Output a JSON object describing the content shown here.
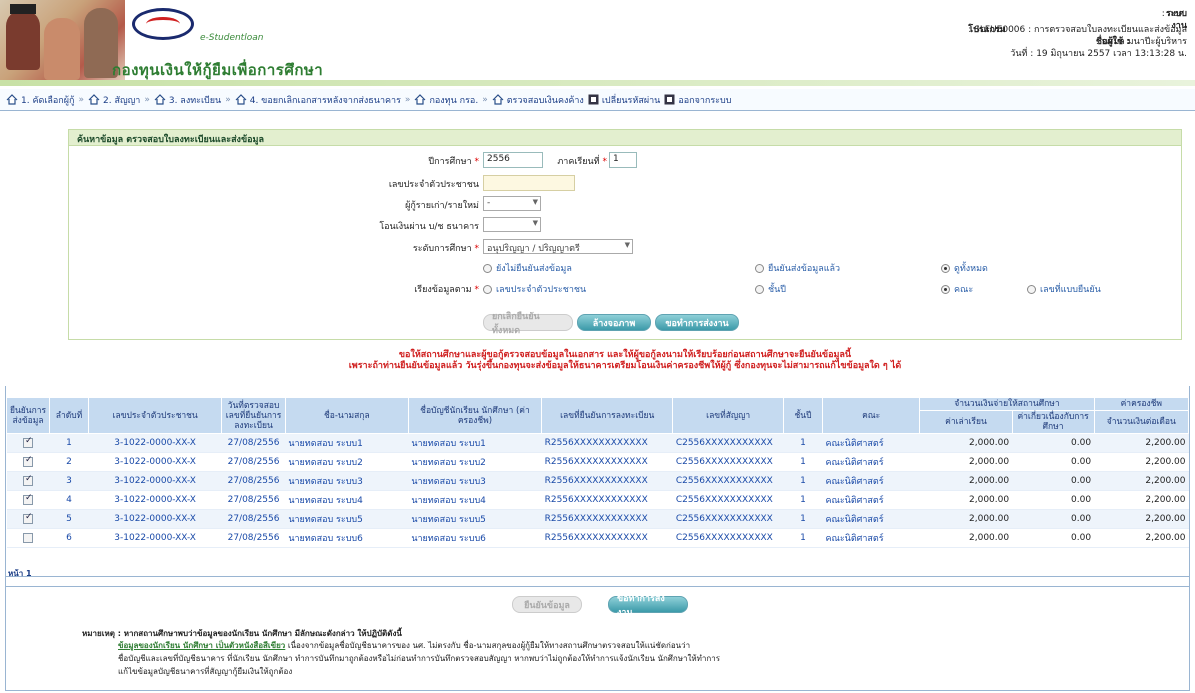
{
  "header": {
    "logo_sub": "e-Studentloan",
    "brand": "กองทุนเงินให้กู้ยืมเพื่อการศึกษา",
    "system_label": "ระบบงาน",
    "system_value": ": กยศ.",
    "program_label": "โปรแกรม",
    "program_value": ": SLFUE0006 : การตรวจสอบใบลงทะเบียนและส่งข้อมูล",
    "user_label": "ชื่อผู้ใช้ :",
    "user_value": ": นสมล มนาปีะผู้บริหาร",
    "date_value": "วันที่ : 19 มิถุนายน 2557 เวลา 13:13:28 น."
  },
  "menu": [
    {
      "label": "1. คัดเลือกผู้กู้",
      "icon": "home-icon"
    },
    {
      "label": "2. สัญญา",
      "icon": "home-icon"
    },
    {
      "label": "3. ลงทะเบียน",
      "icon": "home-icon"
    },
    {
      "label": "4. ขอยกเลิกเอกสารหลังจากส่งธนาคาร",
      "icon": "home-icon"
    },
    {
      "label": "กองทุน กรอ.",
      "icon": "home-icon"
    },
    {
      "label": "ตรวจสอบเงินคงค้าง",
      "icon": "home-icon"
    },
    {
      "label": "เปลี่ยนรหัสผ่าน",
      "icon": "box-icon"
    },
    {
      "label": "ออกจากระบบ",
      "icon": "box-icon"
    }
  ],
  "search": {
    "title": "ค้นหาข้อมูล ตรวจสอบใบลงทะเบียนและส่งข้อมูล",
    "year_label": "ปีการศึกษา",
    "year_value": "2556",
    "term_label": "ภาคเรียนที่",
    "term_value": "1",
    "citizen_label": "เลขประจำตัวประชาชน",
    "borrower_type_label": "ผู้กู้รายเก่า/รายใหม่",
    "borrower_type_value": "-",
    "transfer_label": "โอนเงินผ่าน บ/ช ธนาคาร",
    "transfer_value": "",
    "level_label": "ระดับการศึกษา",
    "level_value": "อนุปริญญา / ปริญญาตรี",
    "status_options": [
      "ยังไม่ยืนยันส่งข้อมูล",
      "ยืนยันส่งข้อมูลแล้ว",
      "ดูทั้งหมด"
    ],
    "sort_label": "เรียงข้อมูลตาม",
    "sort_options": [
      "เลขประจำตัวประชาชน",
      "ชั้นปี",
      "คณะ",
      "เลขที่แบบยืนยัน"
    ],
    "required_mark": "*",
    "buttons": {
      "confirm_all": "ยกเลิกยืนยันทั้งหมด",
      "clear": "ล้างจอภาพ",
      "process": "ขอทำการส่งงาน"
    }
  },
  "warning_lines": [
    "ขอให้สถานศึกษาและผู้ขอกู้ตรวจสอบข้อมูลในเอกสาร และให้ผู้ขอกู้ลงนามให้เรียบร้อยก่อนสถานศึกษาจะยืนยันข้อมูลนี้",
    "เพราะถ้าท่านยืนยันข้อมูลแล้ว วันรุ่งขึ้นกองทุนจะส่งข้อมูลให้ธนาคารเตรียมโอนเงินค่าครองชีพให้ผู้กู้ ซึ่งกองทุนจะไม่สามารถแก้ไขข้อมูลใด ๆ ได้"
  ],
  "table": {
    "headers": {
      "confirm": "ยืนยันการส่งข้อมูล",
      "no": "ลำดับที่",
      "citizen": "เลขประจำตัวประชาชน",
      "check_date": "วันที่ตรวจสอบ เลขที่ยืนยันการลงทะเบียน",
      "name": "ชื่อ-นามสกุล",
      "account_name": "ชื่อบัญชีนักเรียน นักศึกษา (ค่าครองชีพ)",
      "reg_no": "เลขที่ยืนยันการลงทะเบียน",
      "contract_no": "เลขที่สัญญา",
      "year": "ชั้นปี",
      "faculty": "คณะ",
      "pay_group": "จำนวนเงินจ่ายให้สถานศึกษา",
      "tuition": "ค่าเล่าเรียน",
      "related_fee": "ค่าเกี่ยวเนื่องกับการศึกษา",
      "living_group": "ค่าครองชีพ",
      "monthly": "จำนวนเงินต่อเดือน"
    },
    "rows": [
      {
        "checked": true,
        "no": "1",
        "citizen": "3-1022-0000-XX-X",
        "date": "27/08/2556",
        "name": "นายทดสอบ ระบบ1",
        "account": "นายทดสอบ ระบบ1",
        "reg": "R2556XXXXXXXXXXXX",
        "contract": "C2556XXXXXXXXXXX",
        "year": "1",
        "faculty": "คณะนิติศาสตร์",
        "tuition": "2,000.00",
        "related": "0.00",
        "monthly": "2,200.00"
      },
      {
        "checked": true,
        "no": "2",
        "citizen": "3-1022-0000-XX-X",
        "date": "27/08/2556",
        "name": "นายทดสอบ ระบบ2",
        "account": "นายทดสอบ ระบบ2",
        "reg": "R2556XXXXXXXXXXXX",
        "contract": "C2556XXXXXXXXXXX",
        "year": "1",
        "faculty": "คณะนิติศาสตร์",
        "tuition": "2,000.00",
        "related": "0.00",
        "monthly": "2,200.00"
      },
      {
        "checked": true,
        "no": "3",
        "citizen": "3-1022-0000-XX-X",
        "date": "27/08/2556",
        "name": "นายทดสอบ ระบบ3",
        "account": "นายทดสอบ ระบบ3",
        "reg": "R2556XXXXXXXXXXXX",
        "contract": "C2556XXXXXXXXXXX",
        "year": "1",
        "faculty": "คณะนิติศาสตร์",
        "tuition": "2,000.00",
        "related": "0.00",
        "monthly": "2,200.00"
      },
      {
        "checked": true,
        "no": "4",
        "citizen": "3-1022-0000-XX-X",
        "date": "27/08/2556",
        "name": "นายทดสอบ ระบบ4",
        "account": "นายทดสอบ ระบบ4",
        "reg": "R2556XXXXXXXXXXXX",
        "contract": "C2556XXXXXXXXXXX",
        "year": "1",
        "faculty": "คณะนิติศาสตร์",
        "tuition": "2,000.00",
        "related": "0.00",
        "monthly": "2,200.00"
      },
      {
        "checked": true,
        "no": "5",
        "citizen": "3-1022-0000-XX-X",
        "date": "27/08/2556",
        "name": "นายทดสอบ ระบบ5",
        "account": "นายทดสอบ ระบบ5",
        "reg": "R2556XXXXXXXXXXXX",
        "contract": "C2556XXXXXXXXXXX",
        "year": "1",
        "faculty": "คณะนิติศาสตร์",
        "tuition": "2,000.00",
        "related": "0.00",
        "monthly": "2,200.00"
      },
      {
        "checked": false,
        "no": "6",
        "citizen": "3-1022-0000-XX-X",
        "date": "27/08/2556",
        "name": "นายทดสอบ ระบบ6",
        "account": "นายทดสอบ ระบบ6",
        "reg": "R2556XXXXXXXXXXXX",
        "contract": "C2556XXXXXXXXXXX",
        "year": "1",
        "faculty": "คณะนิติศาสตร์",
        "tuition": "2,000.00",
        "related": "0.00",
        "monthly": "2,200.00"
      }
    ],
    "pager": "หน้า 1"
  },
  "bottom_buttons": {
    "confirm": "ยืนยันข้อมูล",
    "process": "ขอทำการส่งงาน"
  },
  "note": {
    "title": "หมายเหตุ : หากสถานศึกษาพบว่าข้อมูลของนักเรียน นักศึกษา มีลักษณะดังกล่าว ให้ปฏิบัติดังนี้",
    "highlight": "ข้อมูลของนักเรียน นักศึกษา เป็นตัวหนังสือสีเขียว",
    "line1": "เนื่องจากข้อมูลชื่อบัญชีธนาคารของ นศ. ไม่ตรงกับ ชื่อ-นามสกุลของผู้กู้ยืมให้ทางสถานศึกษาตรวจสอบให้แน่ชัดก่อนว่า",
    "line2": "ชื่อบัญชีและเลขที่บัญชีธนาคาร ที่นักเรียน นักศึกษา ทำการบันทึกมาถูกต้องหรือไม่ก่อนทำการบันทึกตรวจสอบสัญญา หากพบว่าไม่ถูกต้องให้ทำการแจ้งนักเรียน นักศึกษาให้ทำการ",
    "line3": "แก้ไขข้อมูลบัญชีธนาคารที่สัญญากู้ยืมเงินให้ถูกต้อง"
  },
  "colors": {
    "accent_green": "#2e7d32",
    "table_header": "#c5daf0",
    "warning_red": "#d02020",
    "button_teal": "#3c9aa9"
  }
}
